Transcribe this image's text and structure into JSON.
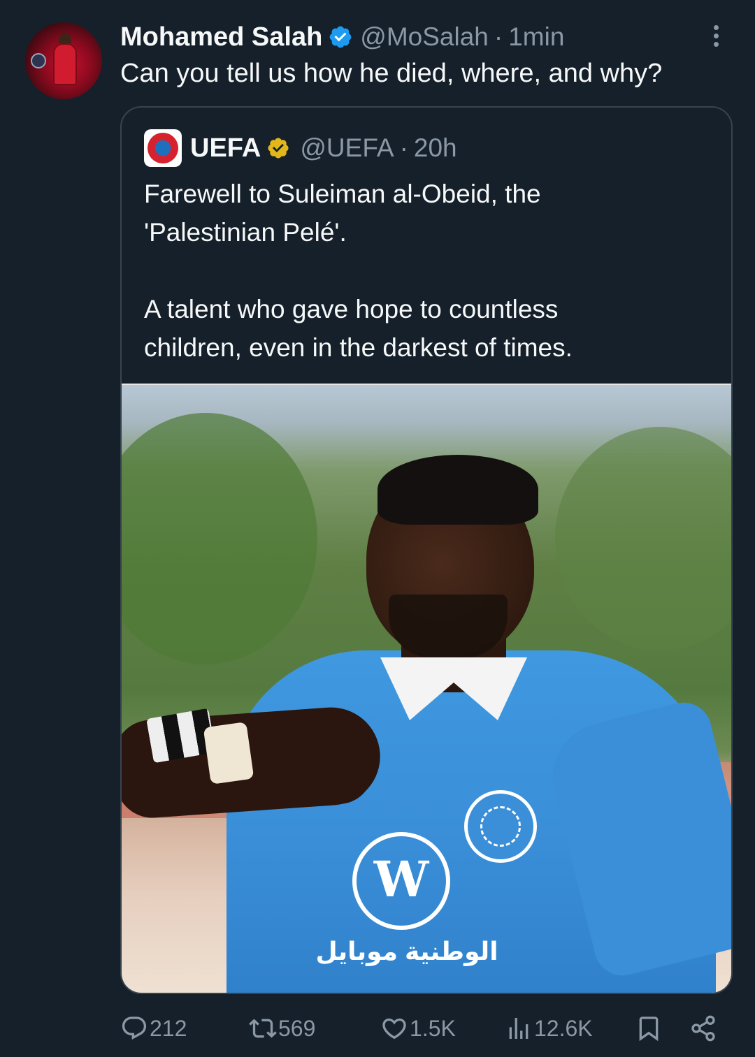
{
  "tweet": {
    "author": {
      "display_name": "Mohamed Salah",
      "handle": "@MoSalah",
      "time": "1min",
      "separator": "·"
    },
    "text": "Can you tell us how he died, where, and why?",
    "colors": {
      "background": "#15202b",
      "text": "#f7f9f9",
      "muted": "#8b98a5",
      "verified_blue": "#1d9bf0",
      "verified_gold": "#e2b719",
      "border": "#38444d"
    }
  },
  "quote": {
    "author": {
      "display_name": "UEFA",
      "handle": "@UEFA",
      "time": "20h",
      "separator": "·"
    },
    "paragraph1_line1": "Farewell to Suleiman al-Obeid, the",
    "paragraph1_line2": "'Palestinian Pelé'.",
    "paragraph2_line1": "A talent who gave hope to countless",
    "paragraph2_line2": "children, even in the darkest of times.",
    "image": {
      "shirt_sponsor_text": "الوطنية موبايل"
    }
  },
  "actions": {
    "replies": "212",
    "reposts": "569",
    "likes": "1.5K",
    "views": "12.6K",
    "icons": [
      "reply-icon",
      "repost-icon",
      "like-icon",
      "views-icon",
      "bookmark-icon",
      "share-icon"
    ]
  }
}
